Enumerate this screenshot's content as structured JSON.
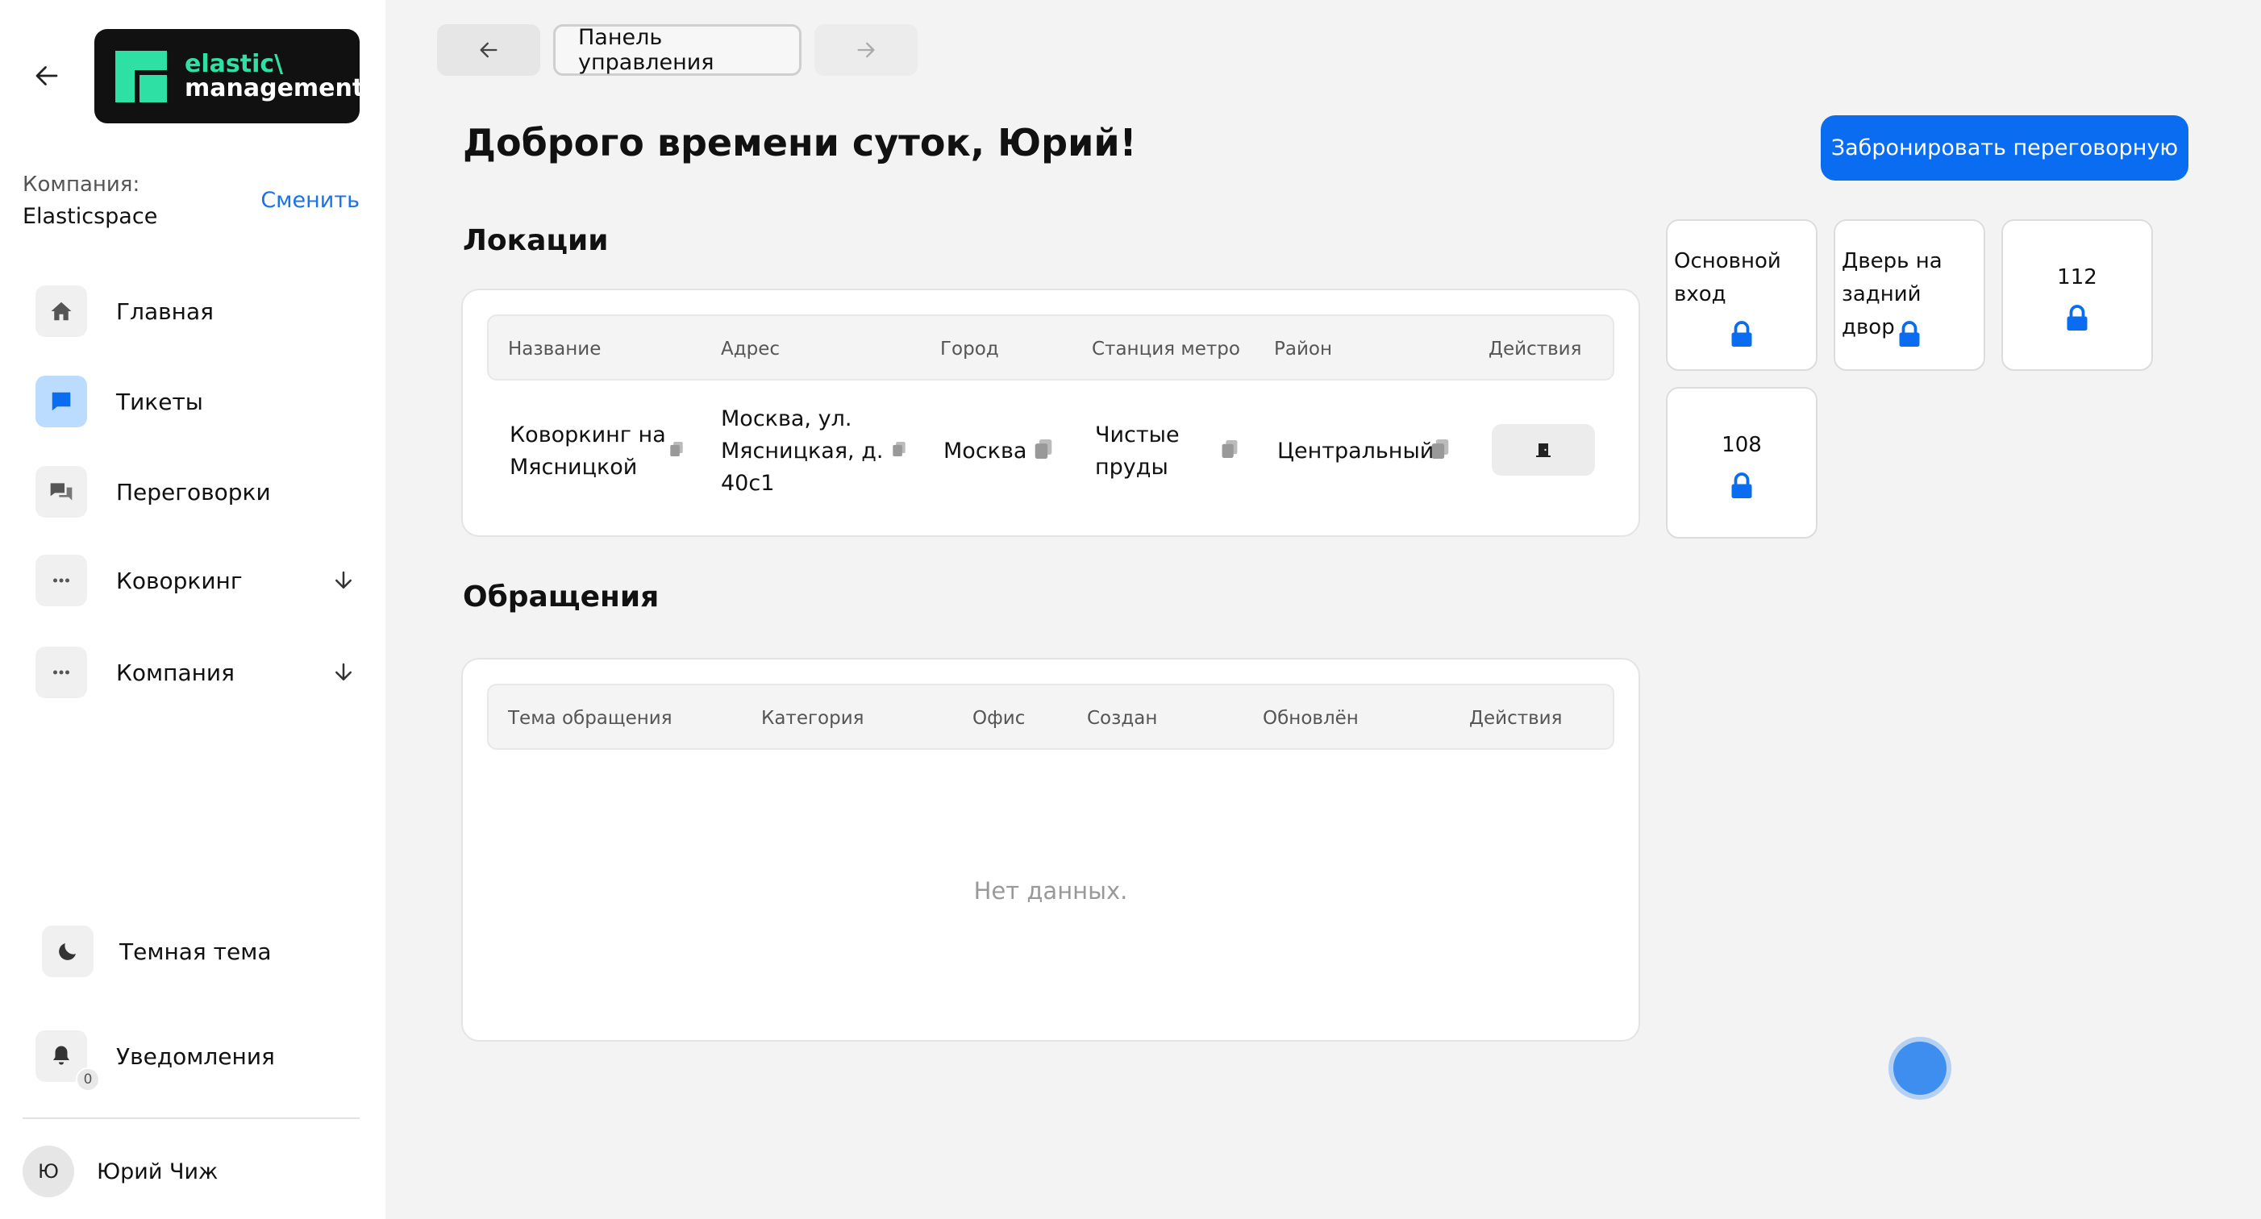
{
  "brand": {
    "line1": "elastic\\",
    "line2": "management",
    "accent_color": "#2fe0a4"
  },
  "company": {
    "label": "Компания:",
    "name": "Elasticspace",
    "change_label": "Сменить"
  },
  "nav": {
    "items": [
      {
        "label": "Главная",
        "icon": "home-icon"
      },
      {
        "label": "Тикеты",
        "icon": "chat-bubble-icon",
        "active": true
      },
      {
        "label": "Переговорки",
        "icon": "chat-bubbles-icon"
      },
      {
        "label": "Коворкинг",
        "icon": "more-dots-icon",
        "expandable": true
      },
      {
        "label": "Компания",
        "icon": "more-dots-icon",
        "expandable": true
      }
    ]
  },
  "theme": {
    "label": "Темная тема",
    "icon": "moon-icon"
  },
  "notifications": {
    "label": "Уведомления",
    "count": "0",
    "icon": "bell-icon"
  },
  "user": {
    "initials": "Ю",
    "name": "Юрий Чиж"
  },
  "topnav": {
    "breadcrumb": "Панель управления"
  },
  "header": {
    "greeting": "Доброго времени суток, Юрий!",
    "book_button": "Забронировать переговорную"
  },
  "locations": {
    "title": "Локации",
    "columns": [
      "Название",
      "Адрес",
      "Город",
      "Станция метро",
      "Район",
      "Действия"
    ],
    "rows": [
      {
        "name_l1": "Коворкинг на",
        "name_l2": "Мясницкой",
        "addr_l1": "Москва, ул.",
        "addr_l2": "Мясницкая, д.",
        "addr_l3": "40с1",
        "city": "Москва",
        "metro_l1": "Чистые",
        "metro_l2": "пруды",
        "district": "Центральный"
      }
    ]
  },
  "requests": {
    "title": "Обращения",
    "columns": [
      "Тема обращения",
      "Категория",
      "Офис",
      "Создан",
      "Обновлён",
      "Действия"
    ],
    "empty_text": "Нет данных."
  },
  "doors": [
    {
      "l1": "Основной",
      "l2": "вход"
    },
    {
      "l1": "Дверь на",
      "l2": "задний двор"
    },
    {
      "l1": "112",
      "l2": ""
    },
    {
      "l1": "108",
      "l2": ""
    }
  ],
  "colors": {
    "primary": "#0a6cf0",
    "active_nav": "#bcdcff",
    "lock": "#0a6cf0"
  }
}
